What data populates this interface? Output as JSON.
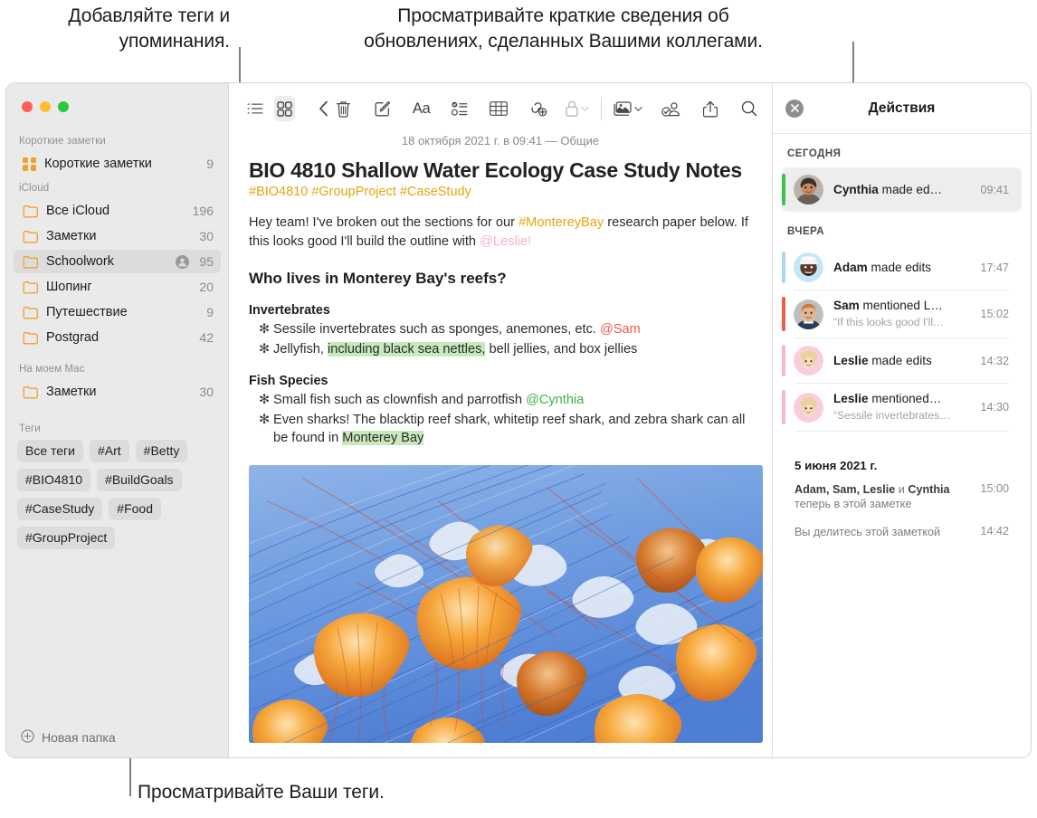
{
  "callouts": {
    "tags": "Добавляйте теги и\nупоминания.",
    "activity": "Просматривайте краткие сведения об\nобновлениях, сделанных Вашими коллегами.",
    "view_tags": "Просматривайте Ваши теги."
  },
  "sidebar": {
    "sections": [
      {
        "label": "Короткие заметки",
        "items": [
          {
            "icon": "quick-notes-icon",
            "label": "Короткие заметки",
            "count": "9",
            "shared": false,
            "selected": false
          }
        ]
      },
      {
        "label": "iCloud",
        "items": [
          {
            "icon": "folder-icon",
            "label": "Все iCloud",
            "count": "196",
            "shared": false,
            "selected": false
          },
          {
            "icon": "folder-icon",
            "label": "Заметки",
            "count": "30",
            "shared": false,
            "selected": false
          },
          {
            "icon": "folder-icon",
            "label": "Schoolwork",
            "count": "95",
            "shared": true,
            "selected": true
          },
          {
            "icon": "folder-icon",
            "label": "Шопинг",
            "count": "20",
            "shared": false,
            "selected": false
          },
          {
            "icon": "folder-icon",
            "label": "Путешествие",
            "count": "9",
            "shared": false,
            "selected": false
          },
          {
            "icon": "folder-icon",
            "label": "Postgrad",
            "count": "42",
            "shared": false,
            "selected": false
          }
        ]
      },
      {
        "label": "На моем Mac",
        "items": [
          {
            "icon": "folder-icon",
            "label": "Заметки",
            "count": "30",
            "shared": false,
            "selected": false
          }
        ]
      }
    ],
    "tags_label": "Теги",
    "tags": [
      "Все теги",
      "#Art",
      "#Betty",
      "#BIO4810",
      "#BuildGoals",
      "#CaseStudy",
      "#Food",
      "#GroupProject"
    ],
    "new_folder_label": "Новая папка"
  },
  "toolbar": {
    "list_view": "list-view-icon",
    "gallery_view": "gallery-view-icon",
    "back": "back-chevron-icon",
    "delete": "trash-icon",
    "compose": "compose-icon",
    "format": "Aa",
    "checklist": "checklist-icon",
    "table": "table-icon",
    "link": "link-add-icon",
    "lock": "lock-icon",
    "media": "media-icon",
    "share_collab": "collaborate-icon",
    "share": "share-icon",
    "search": "search-icon"
  },
  "note": {
    "date": "18 октября 2021 г. в 09:41 — Общие",
    "title": "BIO 4810 Shallow Water Ecology Case Study Notes",
    "tags": "#BIO4810 #GroupProject #CaseStudy",
    "intro_1": "Hey team! I've broken out the sections for our ",
    "intro_tag": "#MontereyBay",
    "intro_2": " research paper below. If this looks good I'll build the outline with ",
    "intro_mention": "@Leslie!",
    "heading": "Who lives in Monterey Bay's reefs?",
    "sections": [
      {
        "subhead": "Invertebrates",
        "bullets": [
          {
            "pre": "Sessile invertebrates such as sponges, anemones, etc. ",
            "mention": "@Sam",
            "mention_color": "red",
            "post": ""
          },
          {
            "pre": "Jellyfish, ",
            "highlight": "including black sea nettles,",
            "post": " bell jellies, and box jellies"
          }
        ]
      },
      {
        "subhead": "Fish Species",
        "bullets": [
          {
            "pre": "Small fish such as clownfish and parrotfish ",
            "mention": "@Cynthia",
            "mention_color": "green",
            "post": ""
          },
          {
            "pre": "Even sharks! The blacktip reef shark, whitetip reef shark, and zebra shark can all be found in ",
            "highlight": "Monterey Bay",
            "post": ""
          }
        ]
      }
    ],
    "image_alt": "jellyfish-photo"
  },
  "activity": {
    "close_icon": "close-icon",
    "title": "Действия",
    "groups": [
      {
        "label": "СЕГОДНЯ",
        "items": [
          {
            "name": "Cynthia",
            "action": " made ed…",
            "quote": "",
            "time": "09:41",
            "bar": "#3cc24b",
            "avatar": "cynthia",
            "highlight": true
          }
        ]
      },
      {
        "label": "ВЧЕРА",
        "items": [
          {
            "name": "Adam",
            "action": " made edits",
            "quote": "",
            "time": "17:47",
            "bar": "#a8d8ef",
            "avatar": "adam",
            "highlight": false
          },
          {
            "name": "Sam",
            "action": " mentioned L…",
            "quote": "“If this looks good I'll…",
            "time": "15:02",
            "bar": "#ef5b4c",
            "avatar": "sam",
            "highlight": false
          },
          {
            "name": "Leslie",
            "action": " made edits",
            "quote": "",
            "time": "14:32",
            "bar": "#f6b8cd",
            "avatar": "leslie",
            "highlight": false
          },
          {
            "name": "Leslie",
            "action": " mentioned…",
            "quote": "“Sessile invertebrates…",
            "time": "14:30",
            "bar": "#f6b8cd",
            "avatar": "leslie",
            "highlight": false
          }
        ]
      }
    ],
    "footer_date": "5 июня 2021 г.",
    "footer_rows": [
      {
        "bold": "Adam, Sam, Leslie",
        "mid": " и ",
        "bold2": "Cynthia",
        "sub": "теперь в этой заметке",
        "time": "15:00"
      },
      {
        "plain": "Вы делитесь этой заметкой",
        "time": "14:42"
      }
    ]
  },
  "colors": {
    "accent_orange": "#f0a22e",
    "tag_yellow": "#e8a313",
    "highlight_green": "#c6e9bd",
    "mention_red": "#ef5b4c",
    "mention_green": "#3cb44a",
    "mention_pink": "#f3b3c5"
  }
}
